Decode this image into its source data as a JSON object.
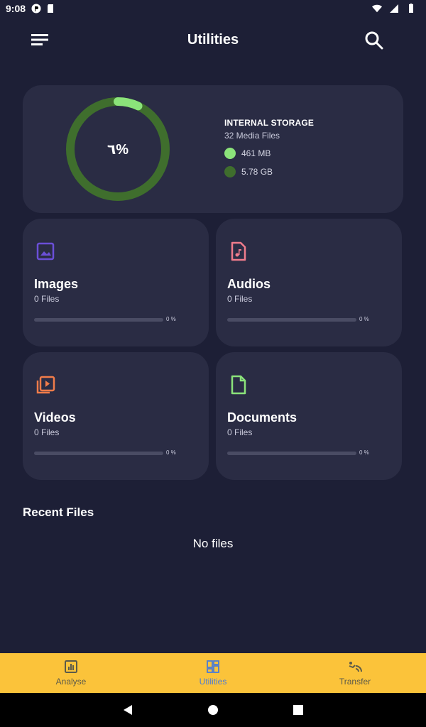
{
  "status_bar": {
    "time": "9:08"
  },
  "header": {
    "title": "Utilities"
  },
  "storage": {
    "percent_label": "٦%",
    "percent_value": 7,
    "title": "INTERNAL STORAGE",
    "subtitle": "32 Media Files",
    "used_label": "461 MB",
    "total_label": "5.78 GB",
    "used_color": "#8be37a",
    "total_color": "#3f6e2d"
  },
  "categories": [
    {
      "name": "Images",
      "count": "0 Files",
      "percent_label": "0 %",
      "progress": 0,
      "icon": "image-icon",
      "color": "#6b4fd8"
    },
    {
      "name": "Audios",
      "count": "0 Files",
      "percent_label": "0 %",
      "progress": 0,
      "icon": "music-file-icon",
      "color": "#f07c8c"
    },
    {
      "name": "Videos",
      "count": "0 Files",
      "percent_label": "0 %",
      "progress": 0,
      "icon": "video-library-icon",
      "color": "#f07c4a"
    },
    {
      "name": "Documents",
      "count": "0 Files",
      "percent_label": "0 %",
      "progress": 0,
      "icon": "document-icon",
      "color": "#8be37a"
    }
  ],
  "recent": {
    "title": "Recent Files",
    "empty_text": "No files"
  },
  "bottom_nav": {
    "items": [
      {
        "label": "Analyse",
        "icon": "analytics-icon",
        "active": false
      },
      {
        "label": "Utilities",
        "icon": "dashboard-icon",
        "active": true
      },
      {
        "label": "Transfer",
        "icon": "transfer-icon",
        "active": false
      }
    ],
    "background": "#fbc33a",
    "active_color": "#4a7bd6"
  }
}
